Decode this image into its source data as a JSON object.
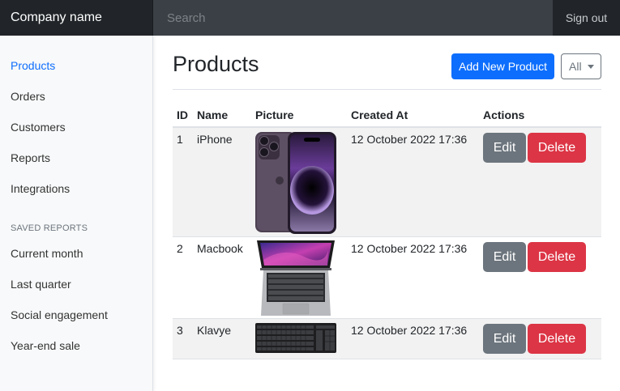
{
  "navbar": {
    "brand": "Company name",
    "search_placeholder": "Search",
    "signout": "Sign out"
  },
  "sidebar": {
    "items": [
      {
        "label": "Products",
        "active": true
      },
      {
        "label": "Orders"
      },
      {
        "label": "Customers"
      },
      {
        "label": "Reports"
      },
      {
        "label": "Integrations"
      }
    ],
    "saved_heading": "SAVED REPORTS",
    "saved_items": [
      {
        "label": "Current month"
      },
      {
        "label": "Last quarter"
      },
      {
        "label": "Social engagement"
      },
      {
        "label": "Year-end sale"
      }
    ]
  },
  "main": {
    "title": "Products",
    "add_button": "Add New Product",
    "filter_value": "All",
    "columns": [
      "ID",
      "Name",
      "Picture",
      "Created At",
      "Actions"
    ],
    "rows": [
      {
        "id": "1",
        "name": "iPhone",
        "created": "12 October 2022 17:36",
        "edit": "Edit",
        "delete": "Delete",
        "picture": "iphone-image"
      },
      {
        "id": "2",
        "name": "Macbook",
        "created": "12 October 2022 17:36",
        "edit": "Edit",
        "delete": "Delete",
        "picture": "macbook-image"
      },
      {
        "id": "3",
        "name": "Klavye",
        "created": "12 October 2022 17:36",
        "edit": "Edit",
        "delete": "Delete",
        "picture": "keyboard-image"
      }
    ]
  },
  "colors": {
    "primary": "#0d6efd",
    "secondary": "#6c757d",
    "danger": "#dc3545",
    "navbar": "#343a40"
  }
}
